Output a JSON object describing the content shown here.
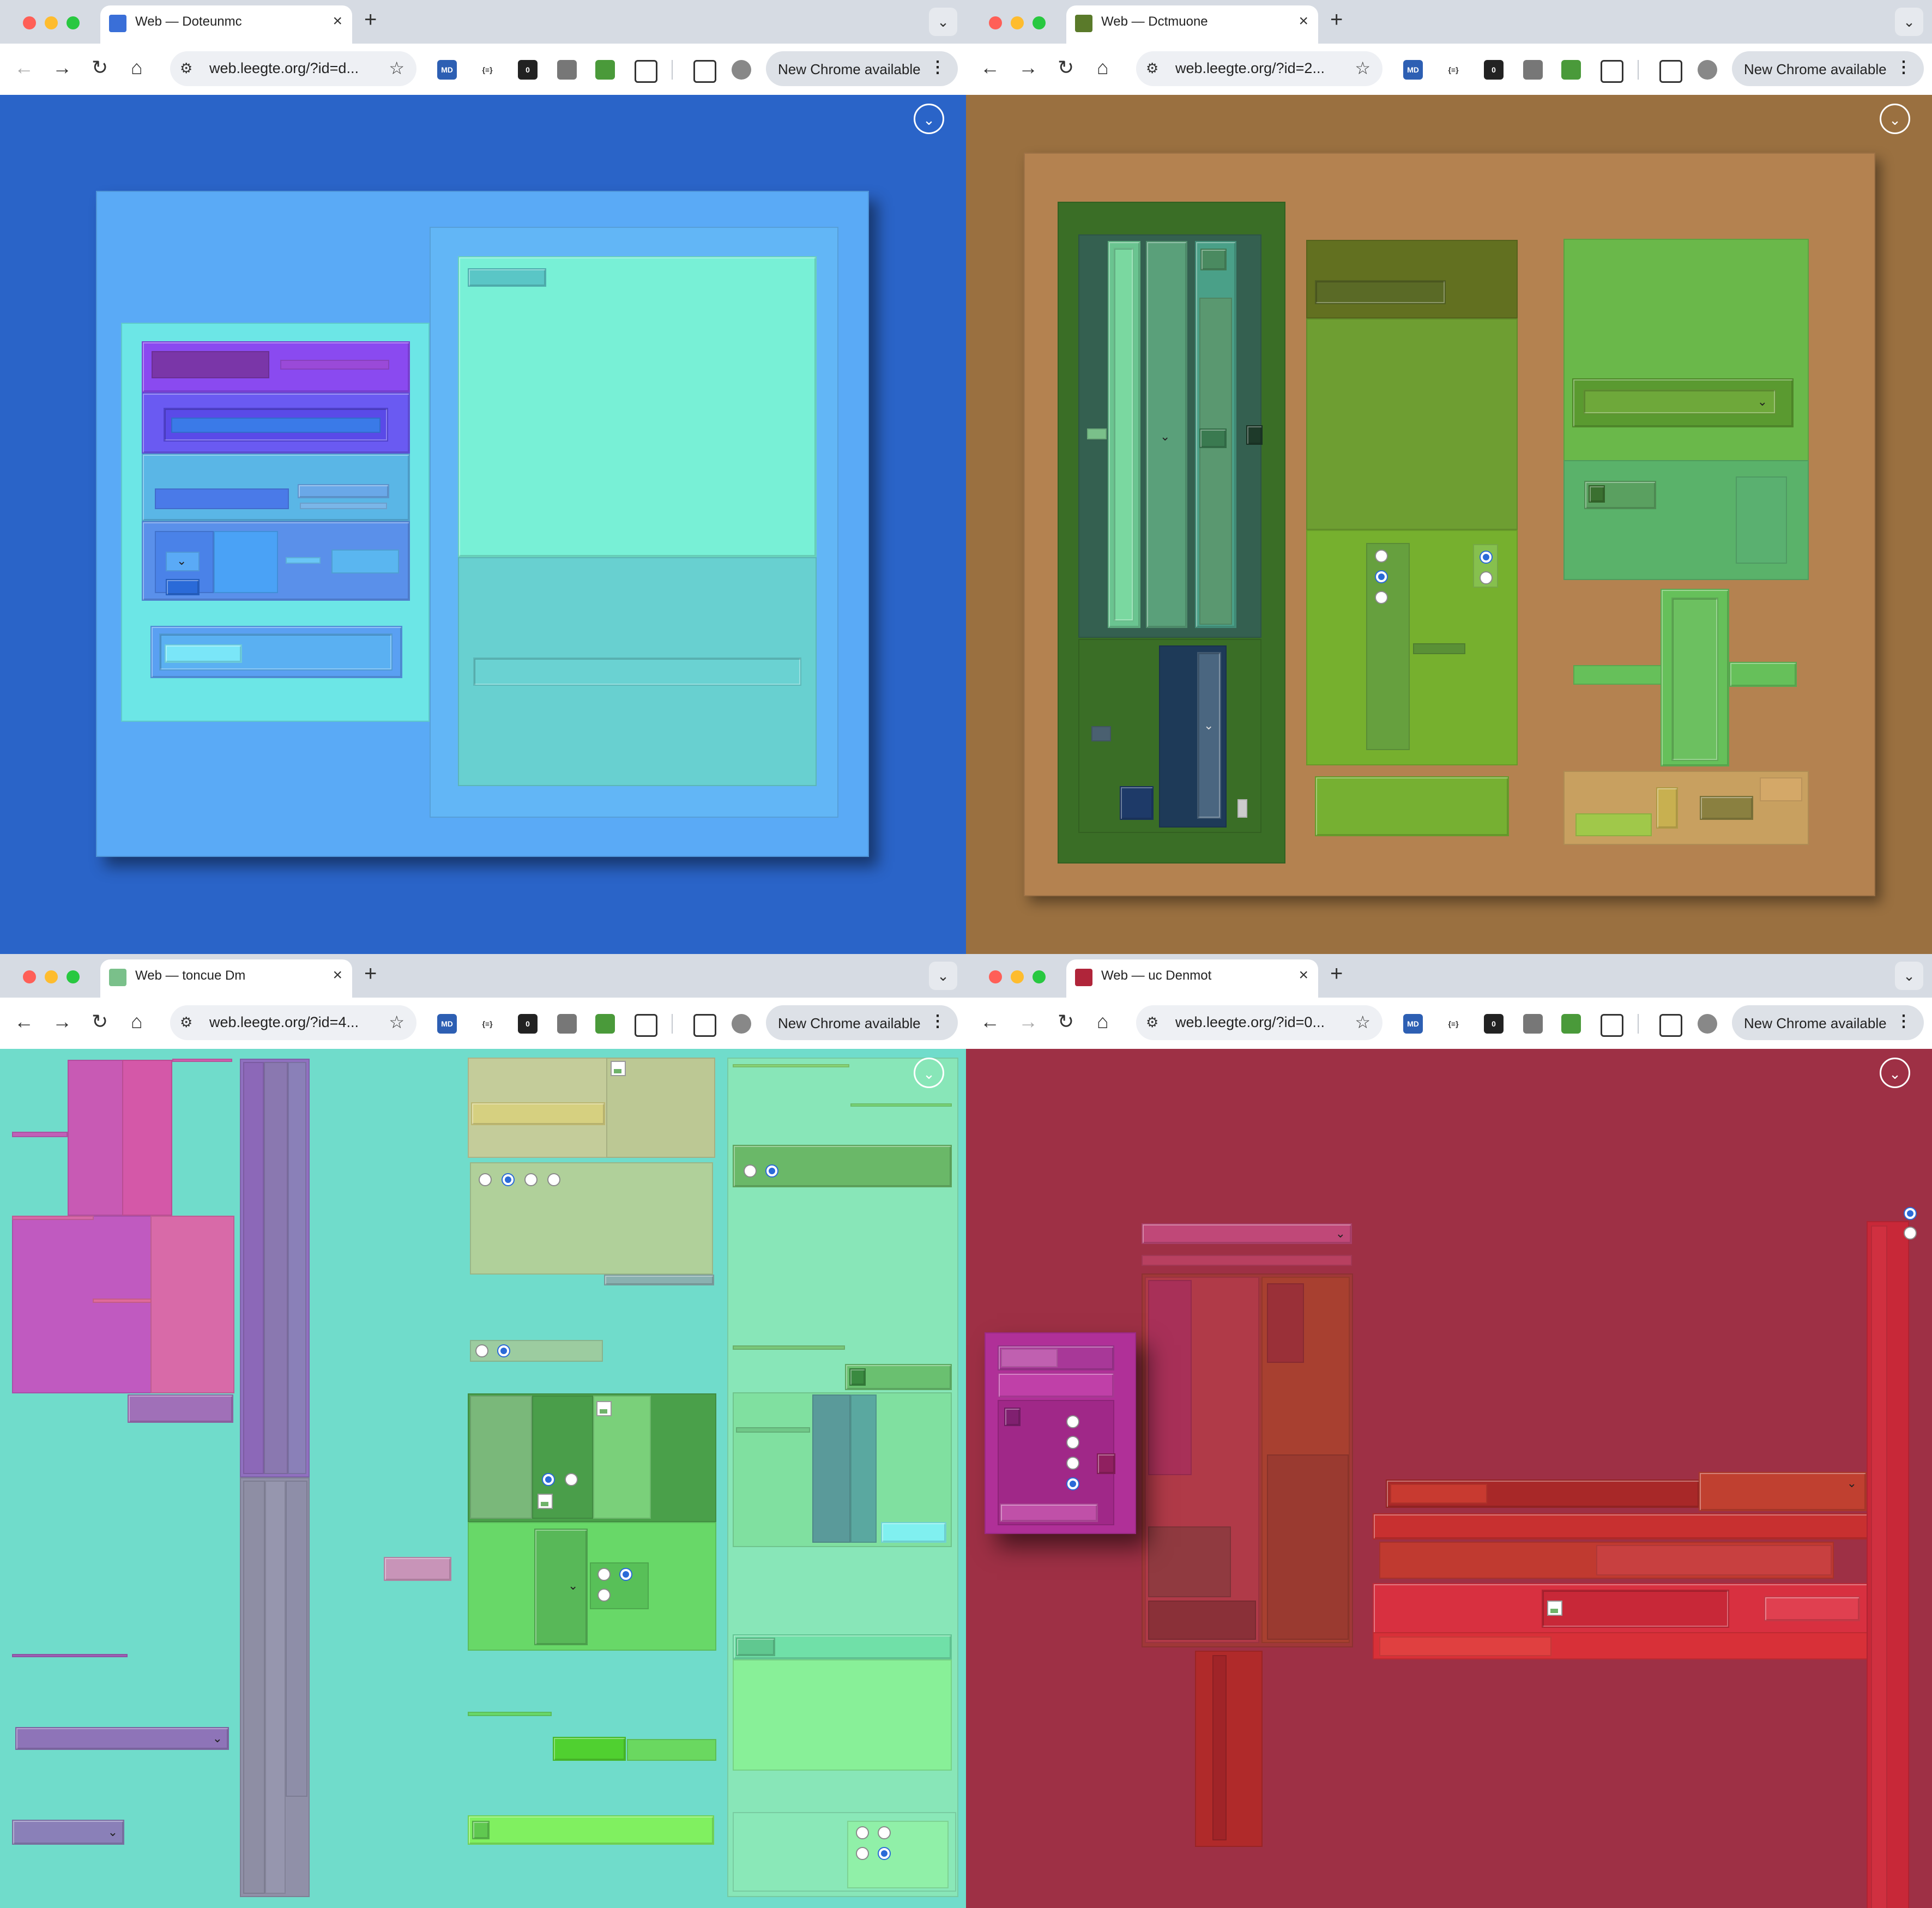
{
  "browser": {
    "tab_close": "×",
    "new_tab": "+",
    "tab_menu": "⌄",
    "nav_back": "←",
    "nav_forward": "→",
    "nav_reload": "↻",
    "nav_home": "⌂",
    "tune_icon": "⚙",
    "bookmark_star": "☆",
    "ext_md": "MD",
    "ext_code": "{≡}",
    "ext_badge": "0",
    "new_chrome_label": "New Chrome available",
    "kebab": "⋮",
    "fab_glyph": "⌄"
  },
  "windows": [
    {
      "tab_title": "Web — Doteunmc",
      "url": "web.leegte.org/?id=d...",
      "bg": "#2a64c8",
      "favicon_color": "#3a6fd8"
    },
    {
      "tab_title": "Web — Dctmuone",
      "url": "web.leegte.org/?id=2...",
      "bg": "#9a7040",
      "favicon_color": "#5a7a2a"
    },
    {
      "tab_title": "Web — toncue Dm",
      "url": "web.leegte.org/?id=4...",
      "bg": "#70dccb",
      "favicon_color": "#7ac08a"
    },
    {
      "tab_title": "Web — uc Denmot",
      "url": "web.leegte.org/?id=0...",
      "bg": "#9e3045",
      "favicon_color": "#b0253a"
    }
  ],
  "colors": {
    "light_red": "#ff5f57",
    "light_yellow": "#febc2e",
    "light_green": "#28c840"
  }
}
